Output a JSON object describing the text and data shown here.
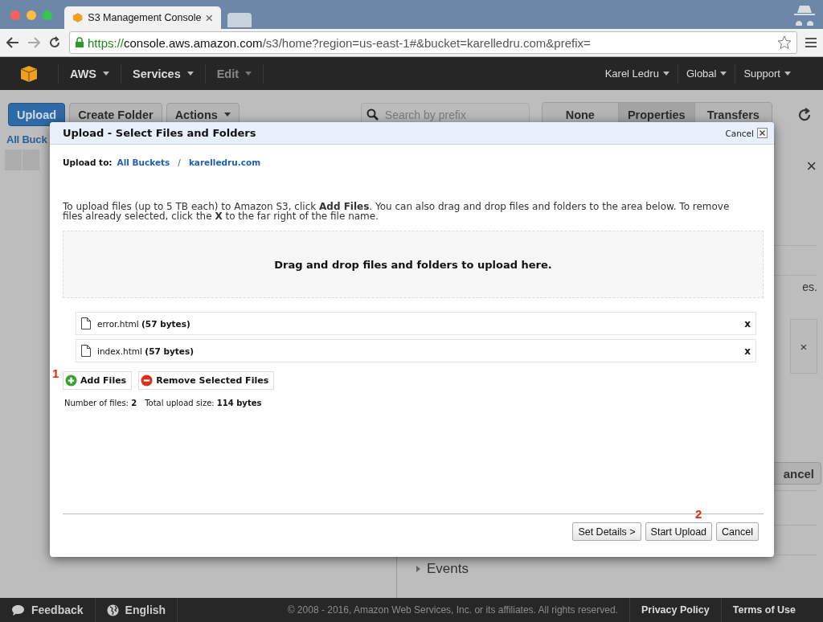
{
  "browser": {
    "tab_title": "S3 Management Console",
    "url_scheme": "https://",
    "url_host": "console.aws.amazon.com",
    "url_path": "/s3/home?region=us-east-1#&bucket=karelledru.com&prefix="
  },
  "navbar": {
    "left": [
      {
        "label": "AWS",
        "disabled": false
      },
      {
        "label": "Services",
        "disabled": false
      },
      {
        "label": "Edit",
        "disabled": true
      }
    ],
    "right": [
      {
        "label": "Karel Ledru"
      },
      {
        "label": "Global"
      },
      {
        "label": "Support"
      }
    ]
  },
  "toolbar": {
    "buttons": [
      {
        "label": "Upload",
        "kind": "primary"
      },
      {
        "label": "Create Folder",
        "kind": "plain"
      },
      {
        "label": "Actions",
        "kind": "dropdown"
      }
    ],
    "search": {
      "placeholder": "Search by prefix"
    },
    "views": [
      {
        "label": "None",
        "selected": false
      },
      {
        "label": "Properties",
        "selected": true
      },
      {
        "label": "Transfers",
        "selected": false
      }
    ]
  },
  "breadcrumb": "All Buck",
  "side_panel": {
    "close": "×",
    "text": "es.",
    "item_close": "×",
    "button": "ancel",
    "sections": [
      "Events"
    ]
  },
  "dialog": {
    "title": "Upload - Select Files and Folders",
    "cancel": "Cancel",
    "upload_to_label": "Upload to:",
    "path": [
      "All Buckets",
      "karelledru.com"
    ],
    "path_separator": "/",
    "instructions": "To upload files (up to 5 TB each) to Amazon S3, click **Add Files**. You can also drag and drop files and folders to the area below. To remove files already selected, click the **X** to the far right of the file name.",
    "drop_zone": "Drag and drop files and folders to upload here.",
    "files": [
      {
        "name": "error.html",
        "size": "(57 bytes)",
        "remove": "x"
      },
      {
        "name": "index.html",
        "size": "(57 bytes)",
        "remove": "x"
      }
    ],
    "actions": [
      {
        "label": "Add Files",
        "kind": "add"
      },
      {
        "label": "Remove Selected Files",
        "kind": "remove"
      }
    ],
    "summary": [
      {
        "label": "Number of files:",
        "value": "2"
      },
      {
        "label": "Total upload size:",
        "value": "114 bytes"
      }
    ],
    "markers": [
      "1",
      "2"
    ],
    "buttons": [
      "Set Details >",
      "Start Upload",
      "Cancel"
    ]
  },
  "footer": {
    "left": [
      {
        "label": "Feedback",
        "kind": "feedback"
      },
      {
        "label": "English",
        "kind": "language"
      }
    ],
    "copyright": "© 2008 - 2016, Amazon Web Services, Inc. or its affiliates. All rights reserved.",
    "links": [
      "Privacy Policy",
      "Terms of Use"
    ]
  }
}
